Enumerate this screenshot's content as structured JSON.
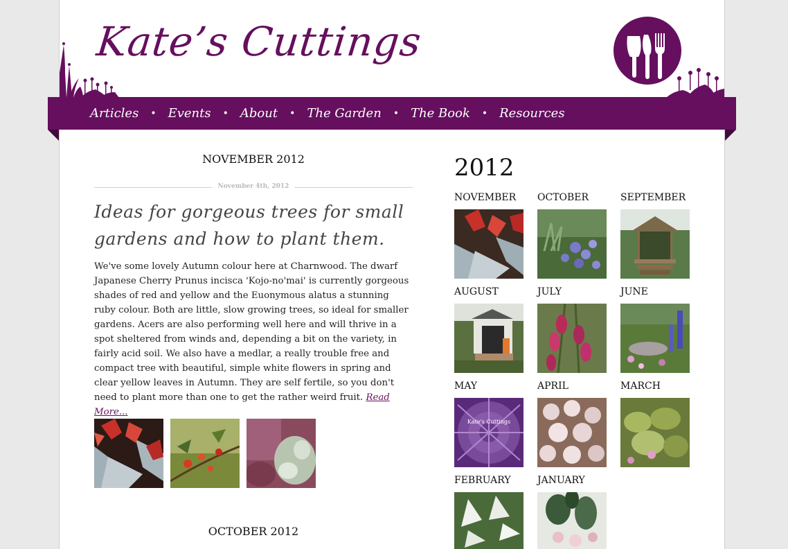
{
  "site": {
    "title": "Kate’s Cuttings",
    "logo_icon": "garden-tools-logo-icon"
  },
  "nav": {
    "items": [
      {
        "label": "Articles"
      },
      {
        "label": "Events"
      },
      {
        "label": "About"
      },
      {
        "label": "The Garden"
      },
      {
        "label": "The Book"
      },
      {
        "label": "Resources"
      }
    ],
    "separator": "•"
  },
  "main": {
    "month_heading": "NOVEMBER 2012",
    "post": {
      "date": "November 4th, 2012",
      "title": "Ideas for gorgeous trees for small gardens and how to plant them.",
      "body": "We've some lovely Autumn colour here at Charnwood. The dwarf Japanese Cherry Prunus incisca 'Kojo-no'mai' is currently gorgeous shades of red and yellow and the Euonymous alatus a stunning ruby colour. Both are little, slow growing trees, so ideal for smaller gardens. Acers are also performing well here and will thrive in a spot sheltered from winds and, depending a bit on the variety, in fairly acid soil. We also have a medlar, a really trouble free and compact tree with beautiful, simple white flowers in spring and clear yellow leaves in Autumn. They are self fertile, so you don't need to plant more than one to get the rather weird fruit.",
      "read_more": "Read More..."
    },
    "next_month_heading": "OCTOBER 2012"
  },
  "archive": {
    "year": "2012",
    "months": [
      "NOVEMBER",
      "OCTOBER",
      "SEPTEMBER",
      "AUGUST",
      "JULY",
      "JUNE",
      "MAY",
      "APRIL",
      "MARCH",
      "FEBRUARY",
      "JANUARY"
    ],
    "may_cover_text": "Kate's Cuttings"
  },
  "colors": {
    "brand": "#650f5e",
    "brand_dark": "#410a3c"
  }
}
